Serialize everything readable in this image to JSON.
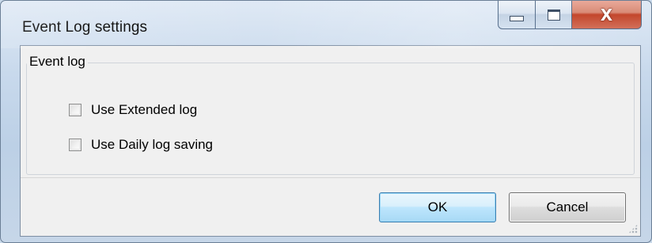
{
  "window": {
    "title": "Event Log settings"
  },
  "caption_buttons": {
    "minimize": "minimize-icon",
    "maximize": "maximize-icon",
    "close": "close-icon",
    "close_glyph": "X"
  },
  "group": {
    "legend": "Event log",
    "options": [
      {
        "label": "Use Extended log",
        "checked": false
      },
      {
        "label": "Use Daily log saving",
        "checked": false
      }
    ]
  },
  "buttons": {
    "ok": "OK",
    "cancel": "Cancel"
  },
  "colors": {
    "ok_border": "#3c7fb1",
    "close_red": "#c3462c"
  }
}
